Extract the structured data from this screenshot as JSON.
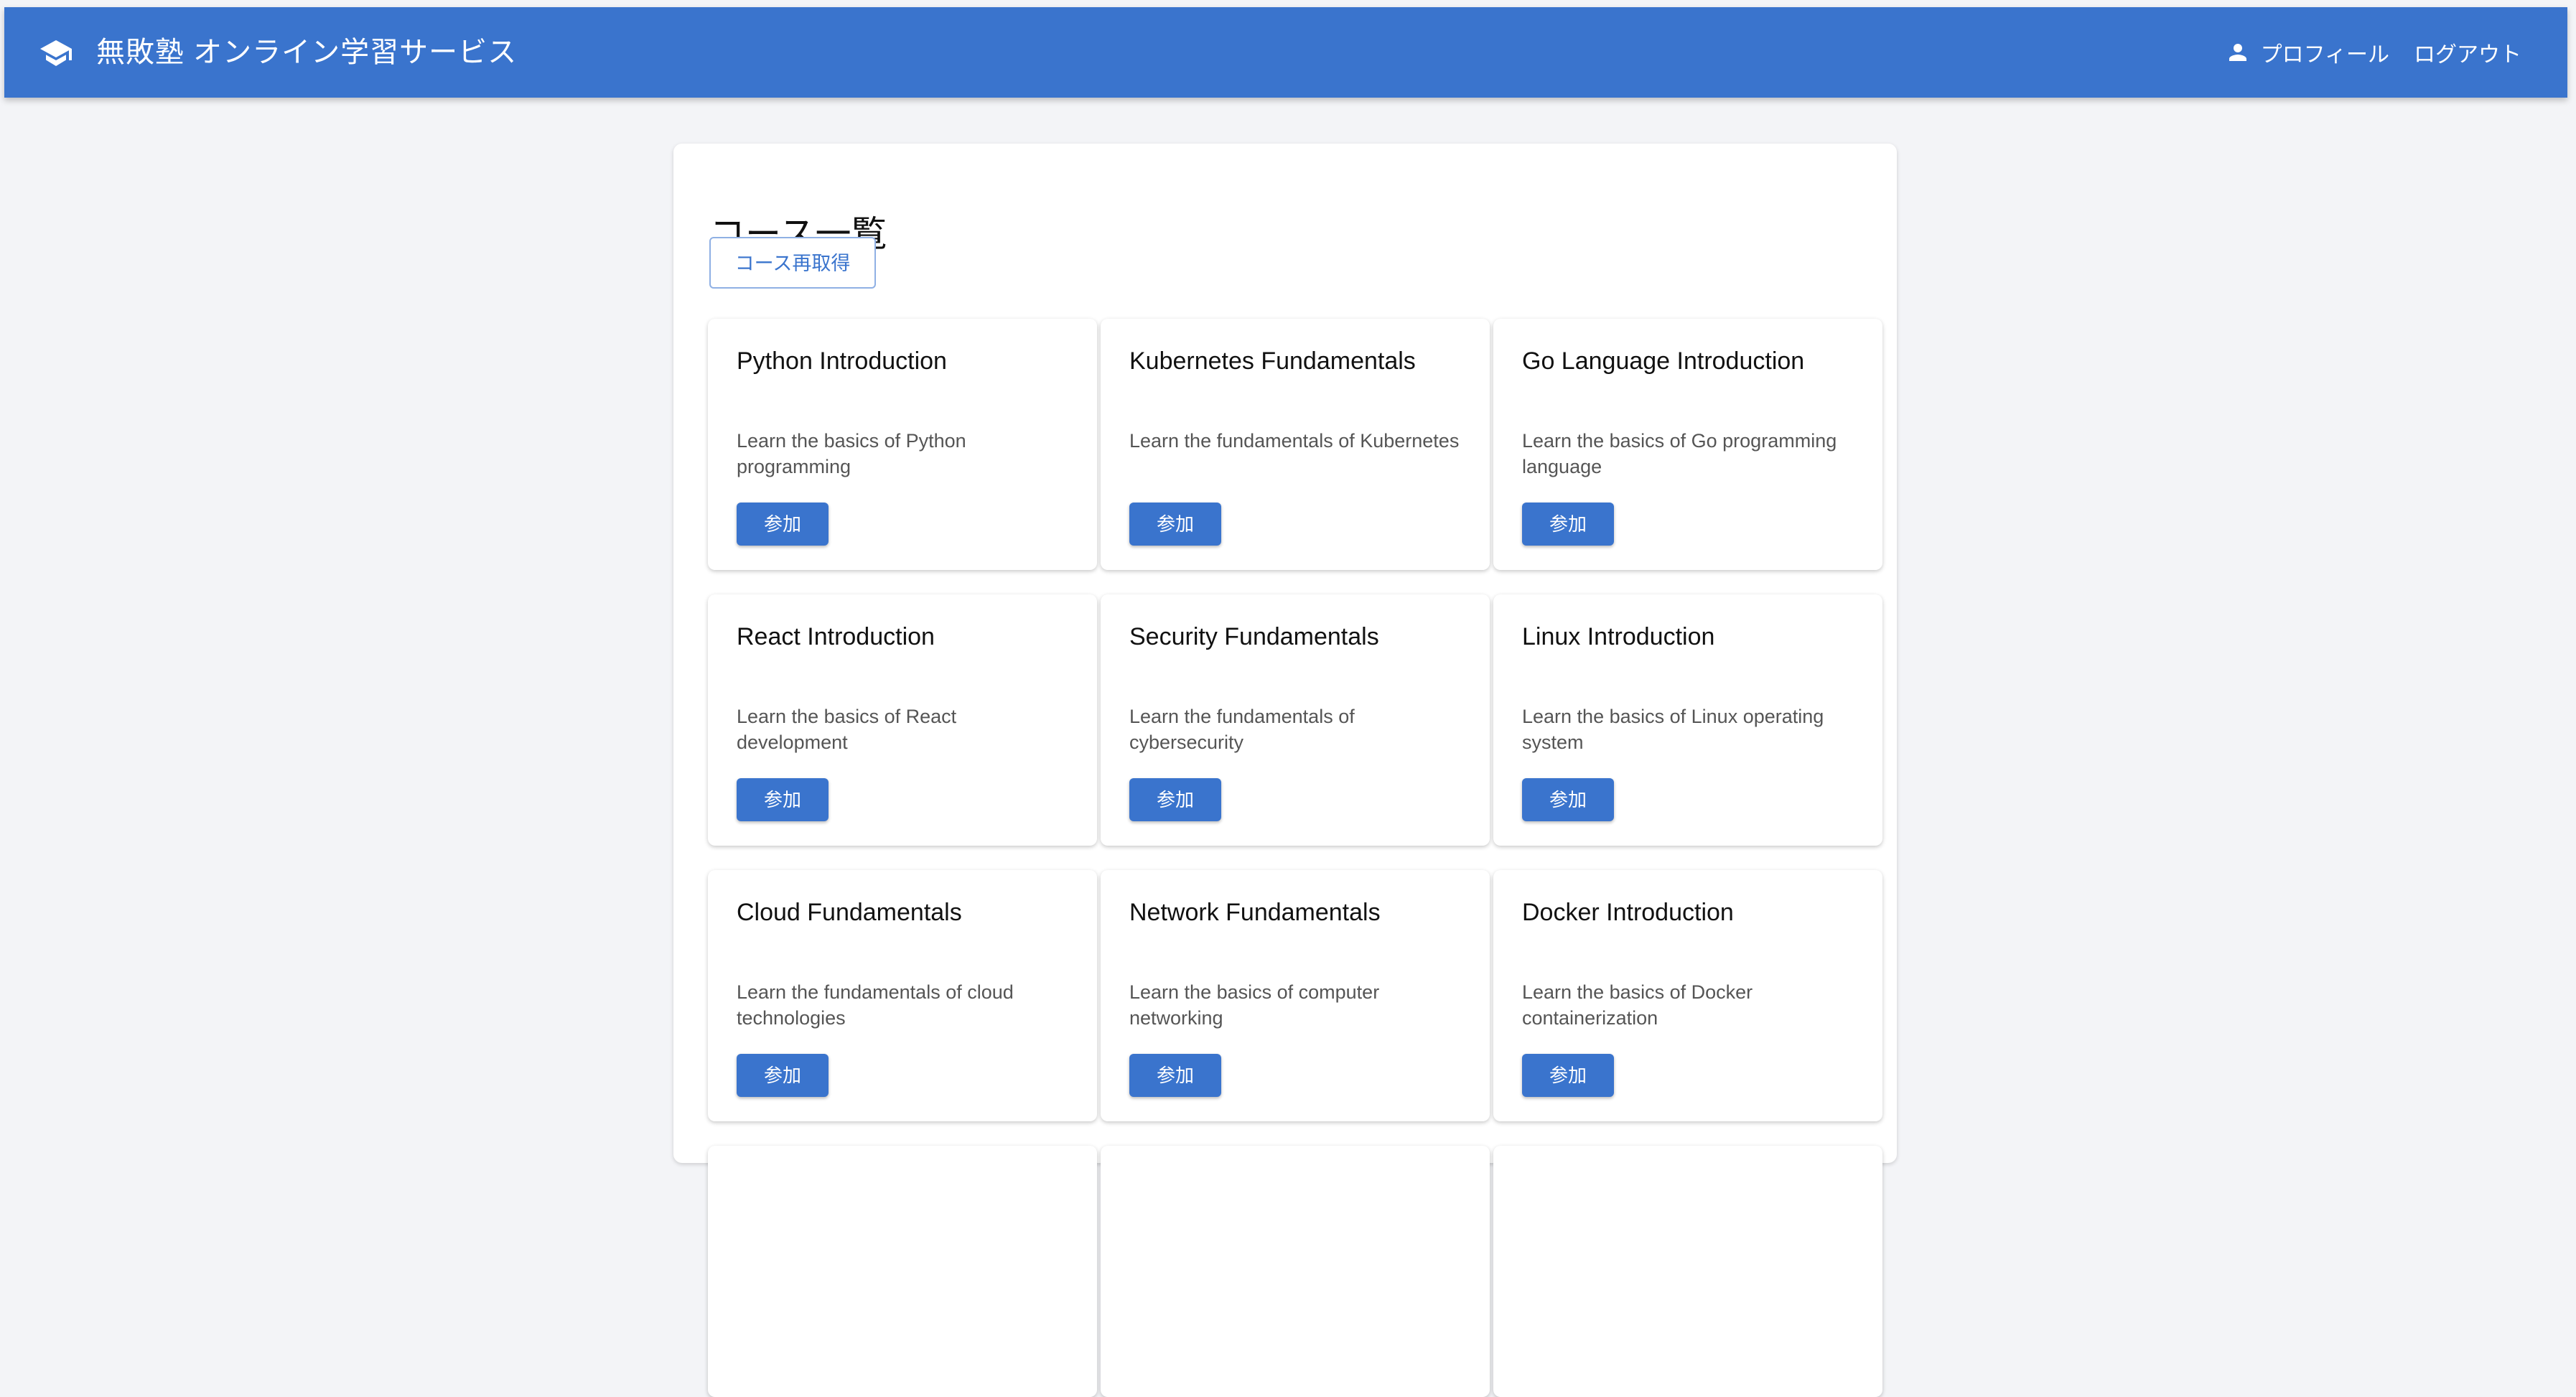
{
  "header": {
    "brand_icon": "graduation-cap-icon",
    "title": "無敗塾 オンライン学習サービス",
    "profile_label": "プロフィール",
    "profile_icon": "person-icon",
    "logout_label": "ログアウト"
  },
  "main": {
    "title": "コース一覧",
    "refresh_label": "コース再取得"
  },
  "courses": [
    {
      "title": "Python Introduction",
      "description": "Learn the basics of Python programming",
      "join_label": "参加"
    },
    {
      "title": "Kubernetes Fundamentals",
      "description": "Learn the fundamentals of Kubernetes",
      "join_label": "参加"
    },
    {
      "title": "Go Language Introduction",
      "description": "Learn the basics of Go programming language",
      "join_label": "参加"
    },
    {
      "title": "React Introduction",
      "description": "Learn the basics of React development",
      "join_label": "参加"
    },
    {
      "title": "Security Fundamentals",
      "description": "Learn the fundamentals of cybersecurity",
      "join_label": "参加"
    },
    {
      "title": "Linux Introduction",
      "description": "Learn the basics of Linux operating system",
      "join_label": "参加"
    },
    {
      "title": "Cloud Fundamentals",
      "description": "Learn the fundamentals of cloud technologies",
      "join_label": "参加"
    },
    {
      "title": "Network Fundamentals",
      "description": "Learn the basics of computer networking",
      "join_label": "参加"
    },
    {
      "title": "Docker Introduction",
      "description": "Learn the basics of Docker containerization",
      "join_label": "参加"
    },
    {
      "title": "",
      "description": "",
      "join_label": ""
    },
    {
      "title": "",
      "description": "",
      "join_label": ""
    },
    {
      "title": "",
      "description": "",
      "join_label": ""
    }
  ],
  "colors": {
    "primary": "#3a74cd",
    "background": "#f3f4f7",
    "card": "#ffffff",
    "text": "#111111",
    "muted_text": "#555555"
  }
}
